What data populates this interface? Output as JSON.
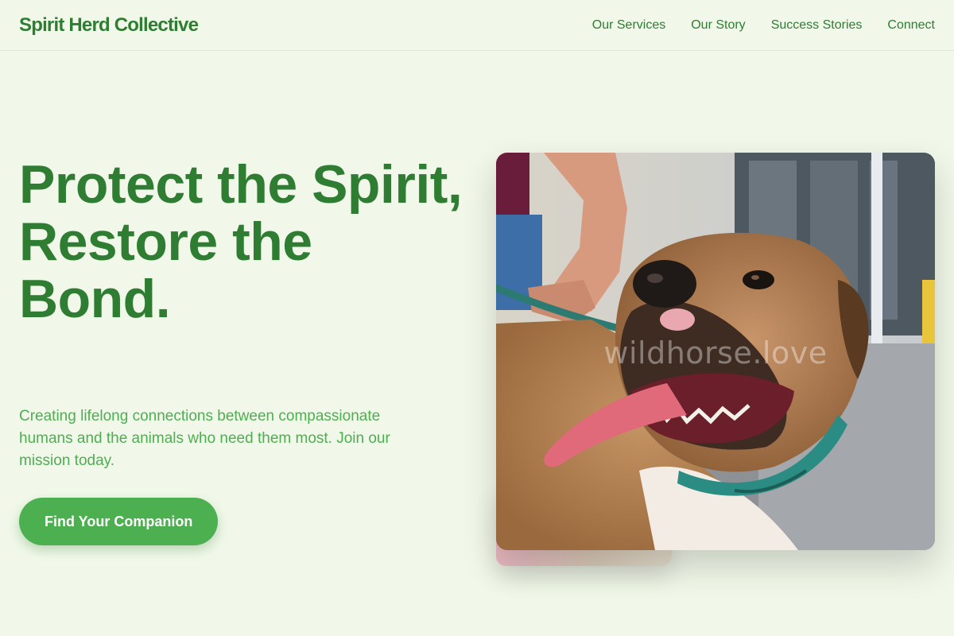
{
  "nav": {
    "brand": "Spirit Herd Collective",
    "links": [
      "Our Services",
      "Our Story",
      "Success Stories",
      "Connect"
    ]
  },
  "hero": {
    "title": "Protect the Spirit, Restore the Bond.",
    "subtitle": "Creating lifelong connections between compassionate humans and the animals who need them most. Join our mission today.",
    "cta_label": "Find Your Companion",
    "image_watermark": "wildhorse.love",
    "image_subject": "dog-photo"
  },
  "colors": {
    "background": "#f1f8e9",
    "primary_dark": "#2e7d32",
    "primary": "#4caf50",
    "button_text": "#ffffff"
  }
}
